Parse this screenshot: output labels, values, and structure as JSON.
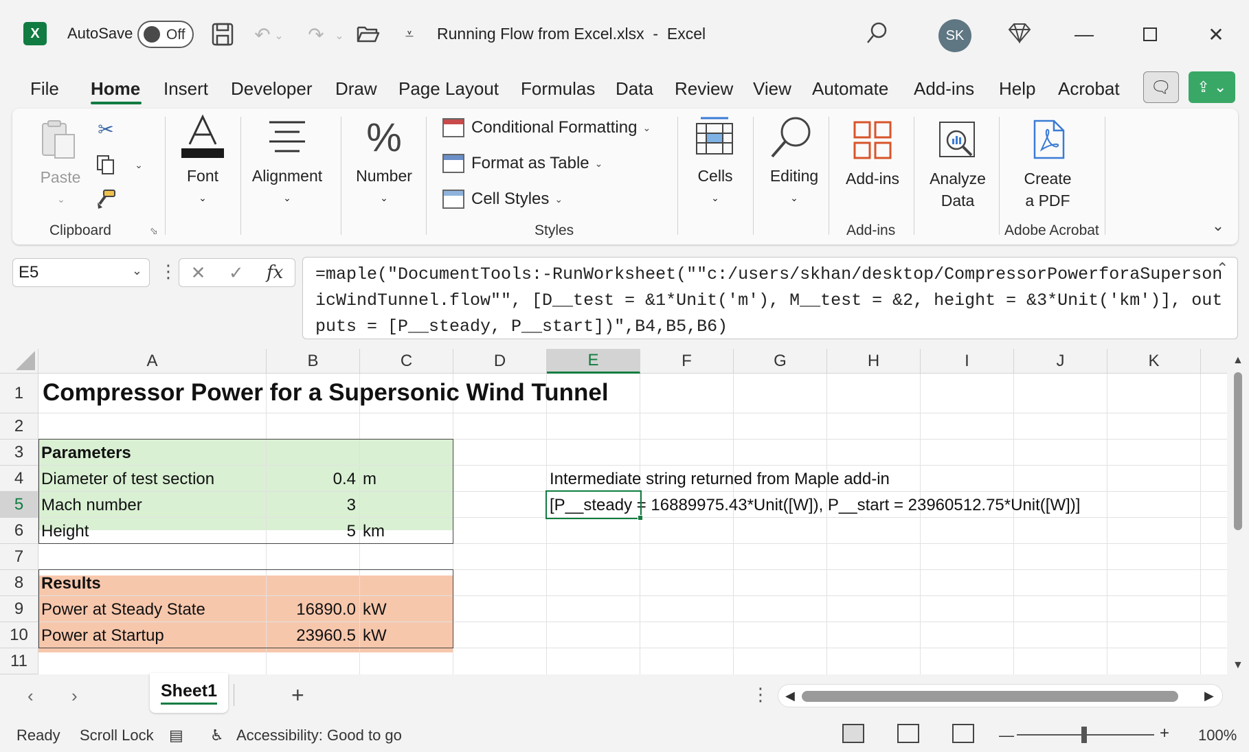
{
  "app": {
    "autosave_label": "AutoSave",
    "autosave_state": "Off",
    "doc_title": "Running Flow from Excel.xlsx  -  Excel",
    "user_initials": "SK",
    "logo_letter": "X"
  },
  "menu": [
    "File",
    "Home",
    "Insert",
    "Developer",
    "Draw",
    "Page Layout",
    "Formulas",
    "Data",
    "Review",
    "View",
    "Automate",
    "Add-ins",
    "Help",
    "Acrobat"
  ],
  "ribbon": {
    "paste": "Paste",
    "clipboard": "Clipboard",
    "font": "Font",
    "alignment": "Alignment",
    "number": "Number",
    "conditional_formatting": "Conditional Formatting",
    "format_as_table": "Format as Table",
    "cell_styles": "Cell Styles",
    "styles": "Styles",
    "cells": "Cells",
    "editing": "Editing",
    "addins_btn": "Add-ins",
    "addins_group": "Add-ins",
    "analyze_1": "Analyze",
    "analyze_2": "Data",
    "create_1": "Create",
    "create_2": "a PDF",
    "acrobat_group": "Adobe Acrobat"
  },
  "formula_bar": {
    "name_box": "E5",
    "formula": "=maple(\"DocumentTools:-RunWorksheet(\"\"c:/users/skhan/desktop/CompressorPowerforaSupersonicWindTunnel.flow\"\", [D__test = &1*Unit('m'), M__test = &2, height = &3*Unit('km')], outputs = [P__steady, P__start])\",B4,B5,B6)"
  },
  "grid": {
    "columns": [
      "A",
      "B",
      "C",
      "D",
      "E",
      "F",
      "G",
      "H",
      "I",
      "J",
      "K"
    ],
    "rows": [
      "1",
      "2",
      "3",
      "4",
      "5",
      "6",
      "7",
      "8",
      "9",
      "10",
      "11"
    ],
    "selected_column": "E",
    "selected_row": "5",
    "cells": {
      "A1": "Compressor Power for a Supersonic Wind Tunnel",
      "A3": "Parameters",
      "A4": "Diameter of test section",
      "B4": "0.4",
      "C4": "m",
      "A5": "Mach number",
      "B5": "3",
      "A6": "Height",
      "B6": "5",
      "C6": "km",
      "A8": "Results",
      "A9": "Power at Steady State",
      "B9": "16890.0",
      "C9": "kW",
      "A10": "Power at Startup",
      "B10": "23960.5",
      "C10": "kW",
      "E4": "Intermediate string returned from Maple add-in",
      "E5": "[P__steady = 16889975.43*Unit([W]), P__start = 23960512.75*Unit([W])]"
    },
    "colors": {
      "parameters_fill": "#d9f0d3",
      "results_fill": "#f7c7ac",
      "accent": "#107c41"
    }
  },
  "sheets": {
    "active": "Sheet1"
  },
  "status": {
    "ready": "Ready",
    "scroll_lock": "Scroll Lock",
    "accessibility": "Accessibility: Good to go",
    "zoom": "100%"
  }
}
